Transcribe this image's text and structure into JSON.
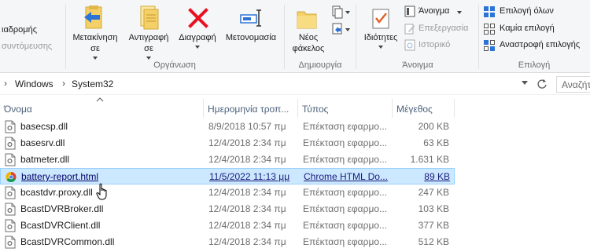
{
  "ribbon": {
    "left_cut_1": "ιαδρομής",
    "left_cut_2": "συντόμευσης",
    "move_label_1": "Μετακίνηση",
    "move_label_2": "σε",
    "copy_label_1": "Αντιγραφή",
    "copy_label_2": "σε",
    "delete_label": "Διαγραφή",
    "rename_label": "Μετονομασία",
    "organize_group": "Οργάνωση",
    "newfolder_label_1": "Νέος",
    "newfolder_label_2": "φάκελος",
    "new_group": "Δημιουργία",
    "properties_label": "Ιδιότητες",
    "open_label": "Άνοιγμα",
    "edit_label": "Επεξεργασία",
    "history_label": "Ιστορικό",
    "open_group": "Άνοιγμα",
    "select_all_label": "Επιλογή όλων",
    "select_none_label": "Καμία επιλογή",
    "invert_selection_label": "Αναστροφή επιλογής",
    "select_group": "Επιλογή"
  },
  "address": {
    "crumbs": [
      "Windows",
      "System32"
    ],
    "search_placeholder": "Αναζήτ"
  },
  "columns": {
    "name": "Όνομα",
    "date": "Ημερομηνία τροπ...",
    "type": "Τύπος",
    "size": "Μέγεθος"
  },
  "files": [
    {
      "name": "basecsp.dll",
      "date": "8/9/2018 10:57 πμ",
      "type": "Επέκταση εφαρμο...",
      "size": "200 KB"
    },
    {
      "name": "basesrv.dll",
      "date": "12/4/2018 2:34 πμ",
      "type": "Επέκταση εφαρμο...",
      "size": "63 KB"
    },
    {
      "name": "batmeter.dll",
      "date": "12/4/2018 2:34 πμ",
      "type": "Επέκταση εφαρμο...",
      "size": "1.631 KB"
    },
    {
      "name": "battery-report.html",
      "date": "11/5/2022 11:13 μμ",
      "type": "Chrome HTML Do...",
      "size": "89 KB"
    },
    {
      "name": "bcastdvr.proxy.dll",
      "date": "12/4/2018 2:34 πμ",
      "type": "Επέκταση εφαρμο...",
      "size": "247 KB"
    },
    {
      "name": "BcastDVRBroker.dll",
      "date": "12/4/2018 2:34 πμ",
      "type": "Επέκταση εφαρμο...",
      "size": "103 KB"
    },
    {
      "name": "BcastDVRClient.dll",
      "date": "12/4/2018 2:34 πμ",
      "type": "Επέκταση εφαρμο...",
      "size": "377 KB"
    },
    {
      "name": "BcastDVRCommon.dll",
      "date": "12/4/2018 2:34 πμ",
      "type": "Επέκταση εφαρμο...",
      "size": "512 KB"
    }
  ],
  "colors": {
    "selection_bg": "#cce8ff",
    "selection_border": "#99d1ff",
    "header_text": "#4c607a",
    "ribbon_bg": "#f5f6f7",
    "delete_red": "#e81123"
  }
}
